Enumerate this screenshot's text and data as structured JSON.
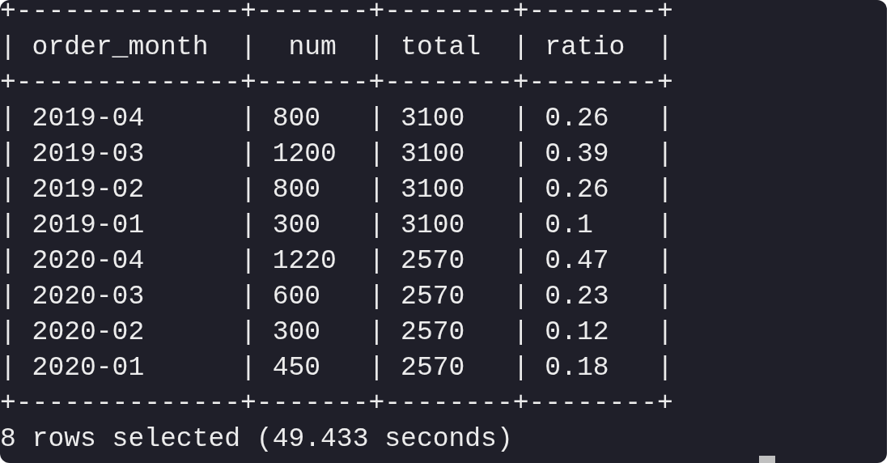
{
  "terminal": {
    "lines": [
      "+--------------+-------+--------+--------+",
      "| order_month  |  num  | total  | ratio  |",
      "+--------------+-------+--------+--------+",
      "| 2019-04      | 800   | 3100   | 0.26   |",
      "| 2019-03      | 1200  | 3100   | 0.39   |",
      "| 2019-02      | 800   | 3100   | 0.26   |",
      "| 2019-01      | 300   | 3100   | 0.1    |",
      "| 2020-04      | 1220  | 2570   | 0.47   |",
      "| 2020-03      | 600   | 2570   | 0.23   |",
      "| 2020-02      | 300   | 2570   | 0.12   |",
      "| 2020-01      | 450   | 2570   | 0.18   |",
      "+--------------+-------+--------+--------+",
      "8 rows selected (49.433 seconds)"
    ]
  }
}
